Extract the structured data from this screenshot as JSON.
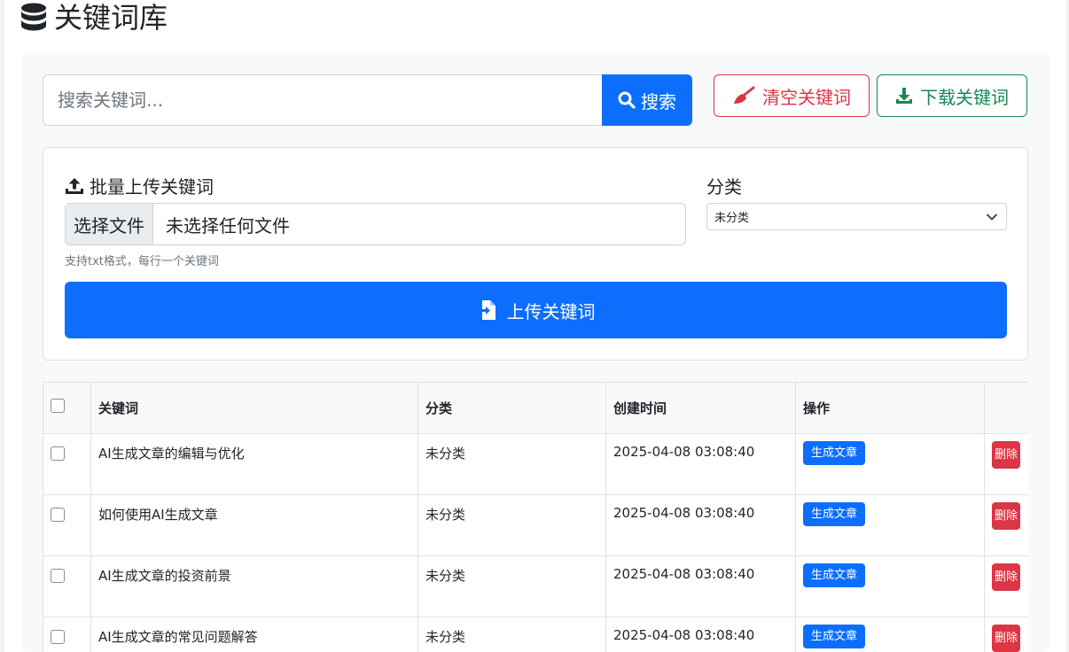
{
  "page": {
    "title": "关键词库"
  },
  "search": {
    "placeholder": "搜索关键词...",
    "button_label": "搜索"
  },
  "actions": {
    "clear_label": "清空关键词",
    "download_label": "下载关键词"
  },
  "upload": {
    "label": "批量上传关键词",
    "file_button": "选择文件",
    "file_status": "未选择任何文件",
    "help": "支持txt格式，每行一个关键词",
    "category_label": "分类",
    "category_value": "未分类",
    "submit_label": "上传关键词"
  },
  "table": {
    "headers": {
      "keyword": "关键词",
      "category": "分类",
      "created": "创建时间",
      "actions": "操作"
    },
    "generate_label": "生成文章",
    "delete_label": "删除",
    "rows": [
      {
        "keyword": "AI生成文章的编辑与优化",
        "category": "未分类",
        "created": "2025-04-08 03:08:40"
      },
      {
        "keyword": "如何使用AI生成文章",
        "category": "未分类",
        "created": "2025-04-08 03:08:40"
      },
      {
        "keyword": "AI生成文章的投资前景",
        "category": "未分类",
        "created": "2025-04-08 03:08:40"
      },
      {
        "keyword": "AI生成文章的常见问题解答",
        "category": "未分类",
        "created": "2025-04-08 03:08:40"
      }
    ]
  },
  "colors": {
    "primary": "#0d6efd",
    "danger": "#dc3545",
    "success": "#198754"
  }
}
